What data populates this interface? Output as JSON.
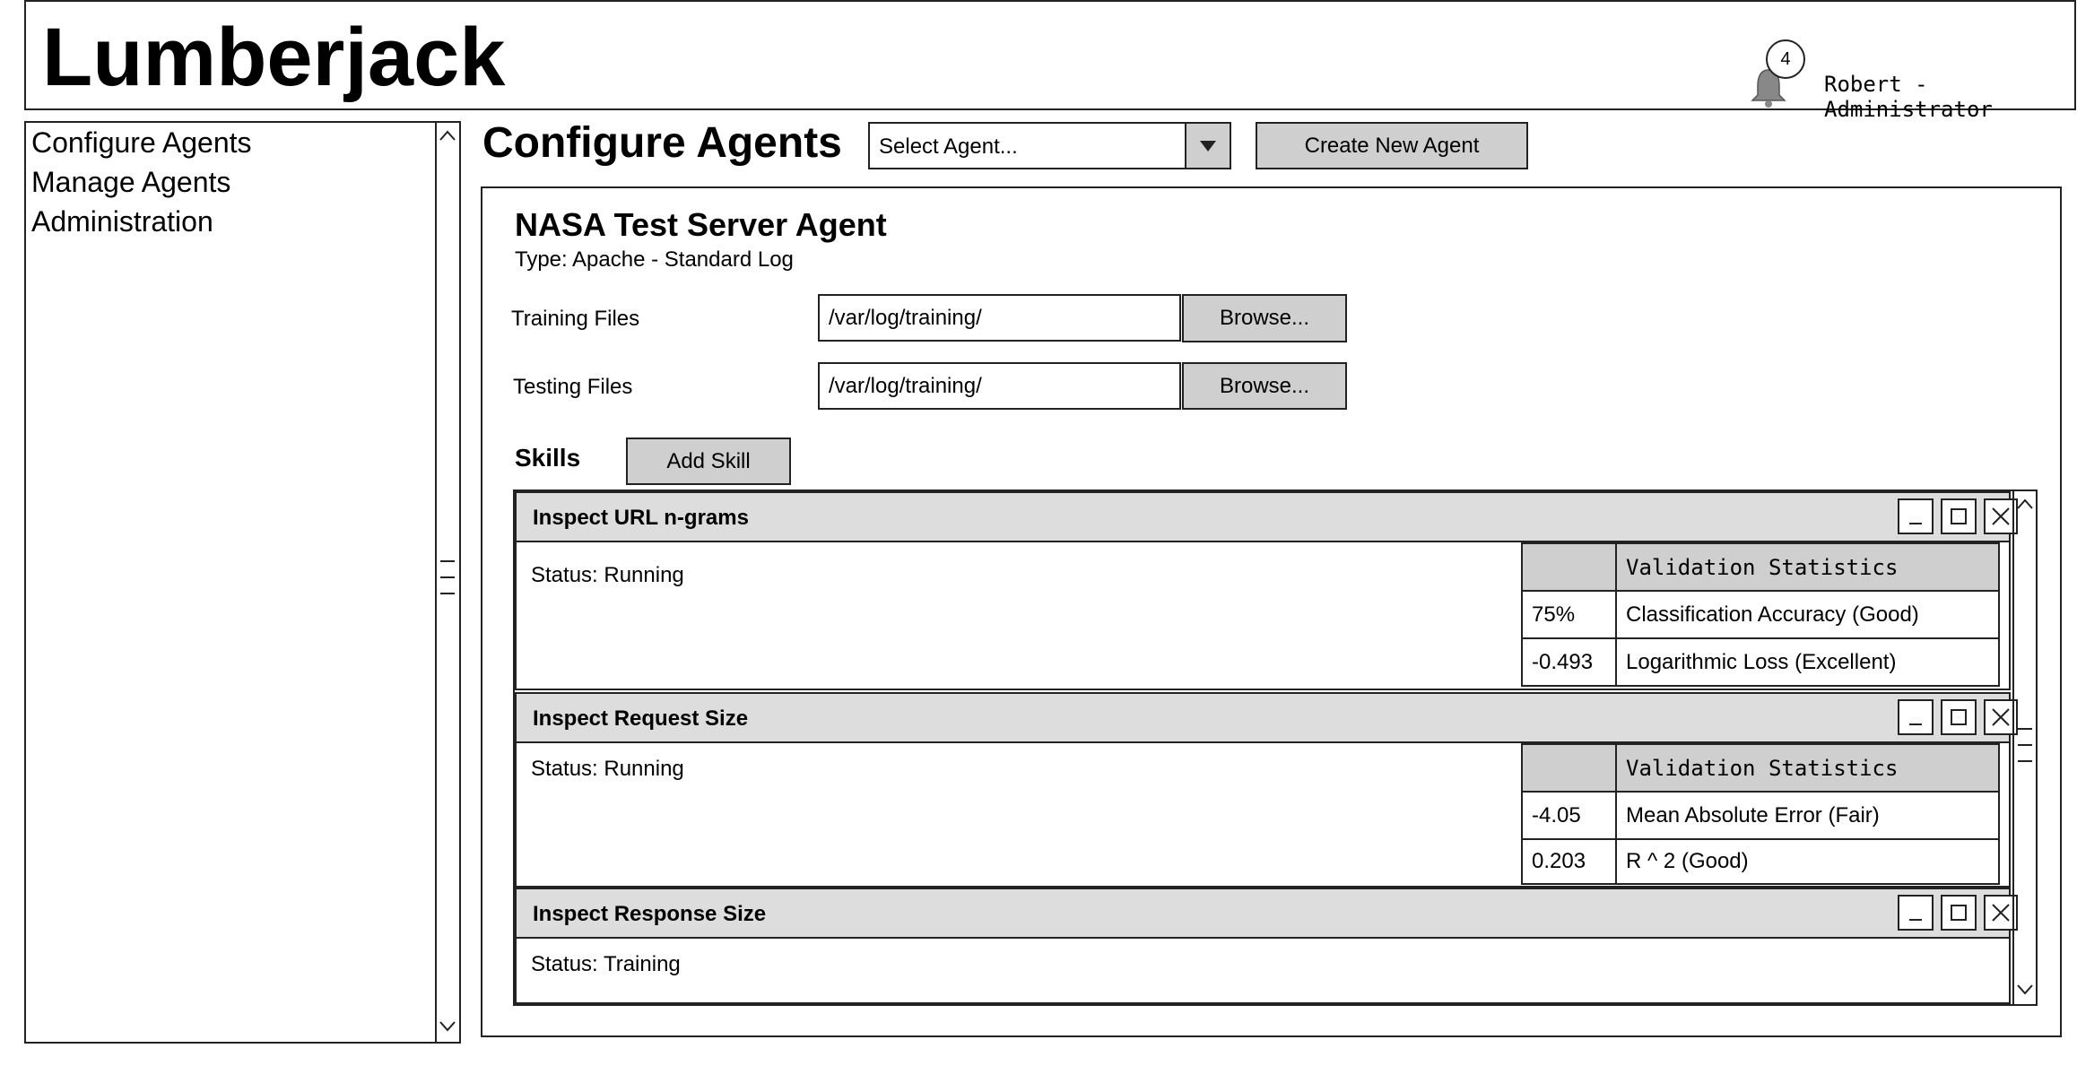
{
  "app": {
    "title": "Lumberjack"
  },
  "header": {
    "notification_count": "4",
    "user": "Robert - Administrator"
  },
  "sidebar": {
    "items": [
      {
        "label": "Configure Agents"
      },
      {
        "label": "Manage Agents"
      },
      {
        "label": "Administration"
      }
    ]
  },
  "page": {
    "title": "Configure Agents",
    "agent_select": {
      "value": "Select Agent..."
    },
    "create_button": "Create New Agent"
  },
  "agent": {
    "name": "NASA Test Server Agent",
    "type": "Type: Apache - Standard Log",
    "training": {
      "label": "Training Files",
      "value": "/var/log/training/",
      "browse": "Browse..."
    },
    "testing": {
      "label": "Testing Files",
      "value": "/var/log/training/",
      "browse": "Browse..."
    },
    "skills_label": "Skills",
    "add_skill": "Add Skill"
  },
  "skills": [
    {
      "title": "Inspect URL n-grams",
      "status": "Status: Running",
      "stats_header": "Validation Statistics",
      "stats": [
        {
          "value": "75%",
          "label": "Classification Accuracy (Good)"
        },
        {
          "value": "-0.493",
          "label": "Logarithmic Loss (Excellent)"
        }
      ]
    },
    {
      "title": "Inspect Request Size",
      "status": "Status: Running",
      "stats_header": "Validation Statistics",
      "stats": [
        {
          "value": "-4.05",
          "label": "Mean Absolute Error (Fair)"
        },
        {
          "value": "0.203",
          "label": "R ^ 2 (Good)"
        }
      ]
    },
    {
      "title": "Inspect Response Size",
      "status": "Status: Training"
    }
  ],
  "icons": {
    "bell": "bell-icon",
    "dropdown": "caret-down-icon",
    "minimize": "minimize-icon",
    "maximize": "maximize-icon",
    "close": "close-icon",
    "scroll_up": "chevron-up-icon",
    "scroll_down": "chevron-down-icon",
    "scroll_grip": "scroll-grip-icon"
  },
  "colors": {
    "panel_header": "#dddddd",
    "button": "#cfcfcf",
    "border": "#222222"
  }
}
